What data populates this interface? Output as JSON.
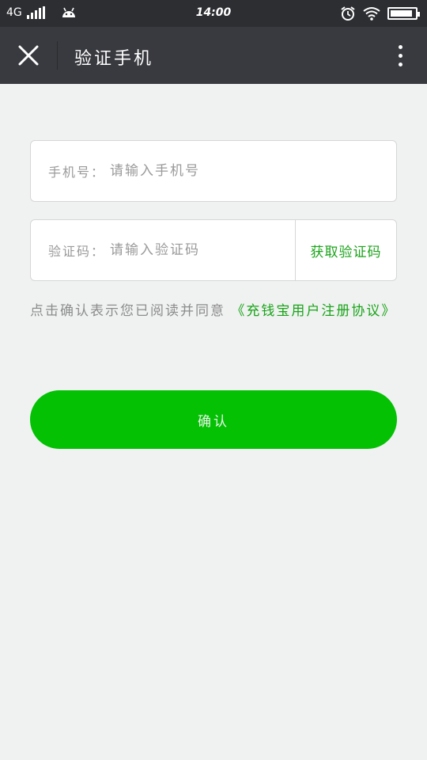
{
  "status_bar": {
    "network": "4G",
    "time": "14:00",
    "battery_level": 0.9
  },
  "app_bar": {
    "title": "验证手机"
  },
  "phone_field": {
    "label": "手机号：",
    "value": "",
    "placeholder": "请输入手机号"
  },
  "code_field": {
    "label": "验证码：",
    "value": "",
    "placeholder": "请输入验证码",
    "get_code_label": "获取验证码"
  },
  "agreement": {
    "text": "点击确认表示您已阅读并同意",
    "link_text": "《充钱宝用户注册协议》"
  },
  "confirm_button": {
    "label": "确认"
  },
  "colors": {
    "accent": "#04c104",
    "link": "#1aa31a",
    "app_bar": "#393a3f",
    "status_bar": "#2d2e32",
    "background": "#eff2f0"
  },
  "icons": [
    "signal-icon",
    "android-icon",
    "alarm-icon",
    "wifi-icon",
    "battery-icon",
    "close-icon",
    "more-vert-icon"
  ]
}
